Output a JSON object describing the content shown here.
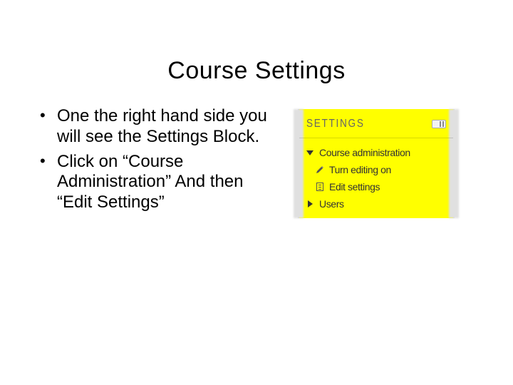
{
  "title": "Course Settings",
  "bullets": [
    "One the right hand side you will see the Settings Block.",
    "Click on “Course Administration” And then “Edit Settings”"
  ],
  "settings_block": {
    "heading": "SETTINGS",
    "items": [
      {
        "label": "Course administration",
        "icon": "triangle-down"
      },
      {
        "label": "Turn editing on",
        "icon": "pencil"
      },
      {
        "label": "Edit settings",
        "icon": "list"
      },
      {
        "label": "Users",
        "icon": "triangle-right"
      }
    ]
  }
}
